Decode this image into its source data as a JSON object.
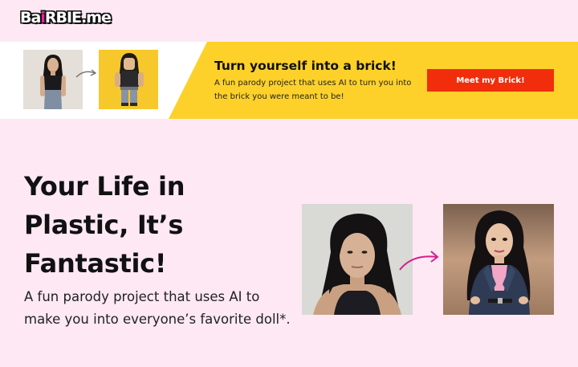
{
  "logo": {
    "part1": "Ba",
    "part2": "i",
    "part3": "RBIE.me"
  },
  "banner": {
    "title": "Turn yourself into a brick!",
    "subtitle": "A fun parody project that uses AI to turn you into the brick you were meant to be!",
    "button_label": "Meet my Brick!"
  },
  "hero": {
    "title": "Your Life in Plastic, It’s Fantastic!",
    "subtitle": "A fun parody project that uses AI to make you into everyone’s favorite doll*."
  },
  "colors": {
    "page_bg": "#fde8f4",
    "banner_yellow": "#fdd12a",
    "button_red": "#f12d0c",
    "accent_pink": "#e8259a"
  },
  "icons": {
    "banner_arrow": "curved-arrow-icon",
    "hero_arrow": "curved-pink-arrow-icon"
  }
}
